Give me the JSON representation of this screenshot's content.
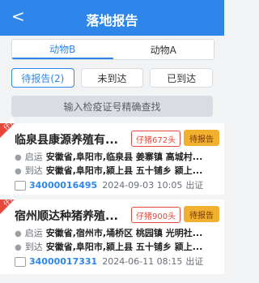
{
  "header": {
    "back_label": "<",
    "title": "落地报告"
  },
  "segments": [
    {
      "label": "动物B",
      "active": true
    },
    {
      "label": "动物A",
      "active": false
    }
  ],
  "tabs": [
    {
      "label": "待报告(2)",
      "active": true
    },
    {
      "label": "未到达",
      "active": false
    },
    {
      "label": "已到达",
      "active": false
    }
  ],
  "search": {
    "placeholder": "输入检疫证号精确查找"
  },
  "cards": [
    {
      "ribbon": "仔猪",
      "name": "临泉县康源养殖有...",
      "pill": "仔猪672头",
      "badge": "待报告",
      "origin_label": "启运",
      "origin": "安徽省,阜阳市,临泉县 姜寨镇 高城村...",
      "dest_label": "到达",
      "dest": "安徽省,阜阳市,颍上县 五十铺乡 颍上...",
      "cert": "34000016495",
      "time": "2024-09-03 10:05",
      "status": "出证"
    },
    {
      "ribbon": "仔猪",
      "name": "宿州顺达种猪养殖...",
      "pill": "仔猪900头",
      "badge": "待报告",
      "origin_label": "启运",
      "origin": "安徽省,宿州市,埇桥区 桃园镇 光明社...",
      "dest_label": "到达",
      "dest": "安徽省,阜阳市,颍上县 五十铺乡 颍上...",
      "cert": "34000017331",
      "time": "2024-06-11 08:15",
      "status": "出证"
    }
  ]
}
